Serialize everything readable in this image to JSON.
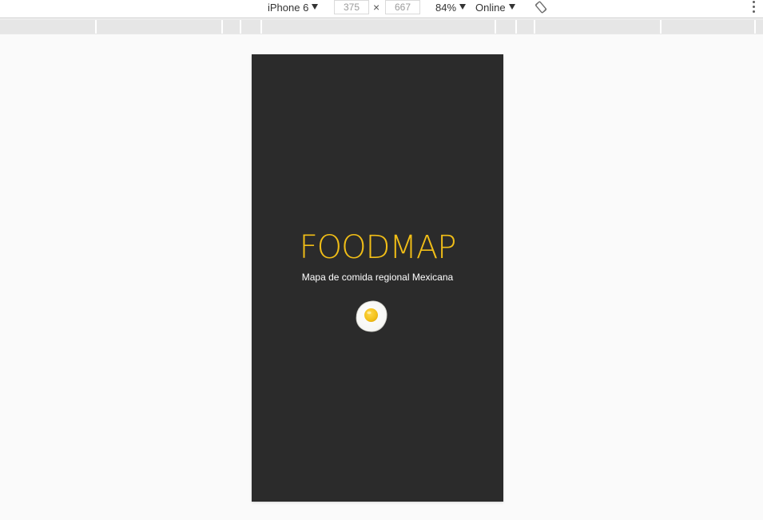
{
  "toolbar": {
    "device": "iPhone 6",
    "width_value": "375",
    "height_value": "667",
    "separator": "×",
    "zoom": "84%",
    "network": "Online",
    "icons": {
      "rotate": "rotate-icon",
      "more": "more-vertical-icon",
      "dropdown": "caret-down-icon"
    }
  },
  "app": {
    "title": "FOODMAP",
    "subtitle": "Mapa de comida regional Mexicana",
    "logo_icon": "fried-egg-icon"
  },
  "colors": {
    "app_background": "#2b2b2b",
    "title": "#f1be17",
    "subtitle": "#ffffff",
    "egg_yolk": "#f2c019",
    "page_background": "#fafafa"
  }
}
